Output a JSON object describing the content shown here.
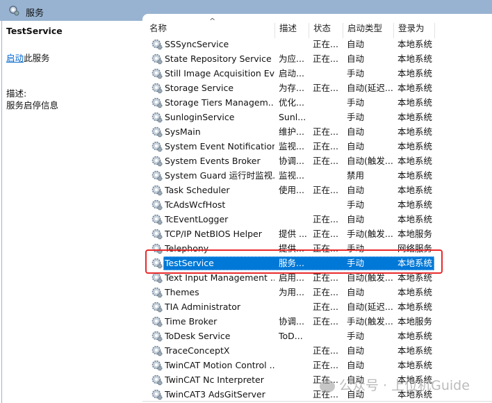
{
  "window": {
    "title": "服务",
    "title_icon": "services-gear-icon"
  },
  "left_panel": {
    "service_name": "TestService",
    "start_link": "启动",
    "start_suffix": "此服务",
    "description_label": "描述:",
    "description": "服务启停信息"
  },
  "columns": [
    "名称",
    "描述",
    "状态",
    "启动类型",
    "登录为"
  ],
  "sort_indicator": "^",
  "rows": [
    {
      "name": "SSSyncService",
      "desc": "",
      "status": "正在...",
      "startup": "自动",
      "logon": "本地系统"
    },
    {
      "name": "State Repository Service",
      "desc": "为应...",
      "status": "正在...",
      "startup": "自动",
      "logon": "本地系统"
    },
    {
      "name": "Still Image Acquisition Ev...",
      "desc": "启动...",
      "status": "",
      "startup": "手动",
      "logon": "本地系统"
    },
    {
      "name": "Storage Service",
      "desc": "为存...",
      "status": "正在...",
      "startup": "自动(延迟...",
      "logon": "本地系统"
    },
    {
      "name": "Storage Tiers Managem...",
      "desc": "优化...",
      "status": "",
      "startup": "手动",
      "logon": "本地系统"
    },
    {
      "name": "SunloginService",
      "desc": "Sunl...",
      "status": "",
      "startup": "手动",
      "logon": "本地系统"
    },
    {
      "name": "SysMain",
      "desc": "维护...",
      "status": "正在...",
      "startup": "自动",
      "logon": "本地系统"
    },
    {
      "name": "System Event Notification...",
      "desc": "监视...",
      "status": "正在...",
      "startup": "自动",
      "logon": "本地系统"
    },
    {
      "name": "System Events Broker",
      "desc": "协调...",
      "status": "正在...",
      "startup": "自动(触发...",
      "logon": "本地系统"
    },
    {
      "name": "System Guard 运行时监视...",
      "desc": "监视...",
      "status": "",
      "startup": "禁用",
      "logon": "本地系统"
    },
    {
      "name": "Task Scheduler",
      "desc": "使用...",
      "status": "正在...",
      "startup": "自动",
      "logon": "本地系统"
    },
    {
      "name": "TcAdsWcfHost",
      "desc": "",
      "status": "",
      "startup": "手动",
      "logon": "本地系统"
    },
    {
      "name": "TcEventLogger",
      "desc": "",
      "status": "正在...",
      "startup": "自动",
      "logon": "本地系统"
    },
    {
      "name": "TCP/IP NetBIOS Helper",
      "desc": "提供 ...",
      "status": "正在...",
      "startup": "手动(触发...",
      "logon": "本地服务"
    },
    {
      "name": "Telephony",
      "desc": "提供...",
      "status": "正在...",
      "startup": "手动",
      "logon": "网络服务"
    },
    {
      "name": "TestService",
      "desc": "服务...",
      "status": "",
      "startup": "手动",
      "logon": "本地系统",
      "selected": true
    },
    {
      "name": "Text Input Management ...",
      "desc": "启用...",
      "status": "正在...",
      "startup": "自动(触发...",
      "logon": "本地系统"
    },
    {
      "name": "Themes",
      "desc": "为用...",
      "status": "正在...",
      "startup": "自动",
      "logon": "本地系统"
    },
    {
      "name": "TIA Administrator",
      "desc": "",
      "status": "正在...",
      "startup": "自动(延迟...",
      "logon": "本地系统"
    },
    {
      "name": "Time Broker",
      "desc": "协调...",
      "status": "正在...",
      "startup": "手动(触发...",
      "logon": "本地服务"
    },
    {
      "name": "ToDesk Service",
      "desc": "ToD...",
      "status": "",
      "startup": "手动",
      "logon": "本地系统"
    },
    {
      "name": "TraceConceptX",
      "desc": "",
      "status": "正在...",
      "startup": "自动",
      "logon": "本地系统"
    },
    {
      "name": "TwinCAT Motion Control ...",
      "desc": "",
      "status": "正在...",
      "startup": "自动",
      "logon": "本地系统"
    },
    {
      "name": "TwinCAT Nc Interpreter",
      "desc": "",
      "status": "正在...",
      "startup": "自动",
      "logon": "本地系统"
    },
    {
      "name": "TwinCAT3 AdsGitServer",
      "desc": "",
      "status": "正在...",
      "startup": "自动",
      "logon": "本地系统"
    }
  ],
  "watermark": "公众号 · 上位机Guide",
  "colors": {
    "titlebar": "#98b3d1",
    "selection": "#0078d7",
    "highlight_box": "#e8292b",
    "link": "#0066cc"
  }
}
